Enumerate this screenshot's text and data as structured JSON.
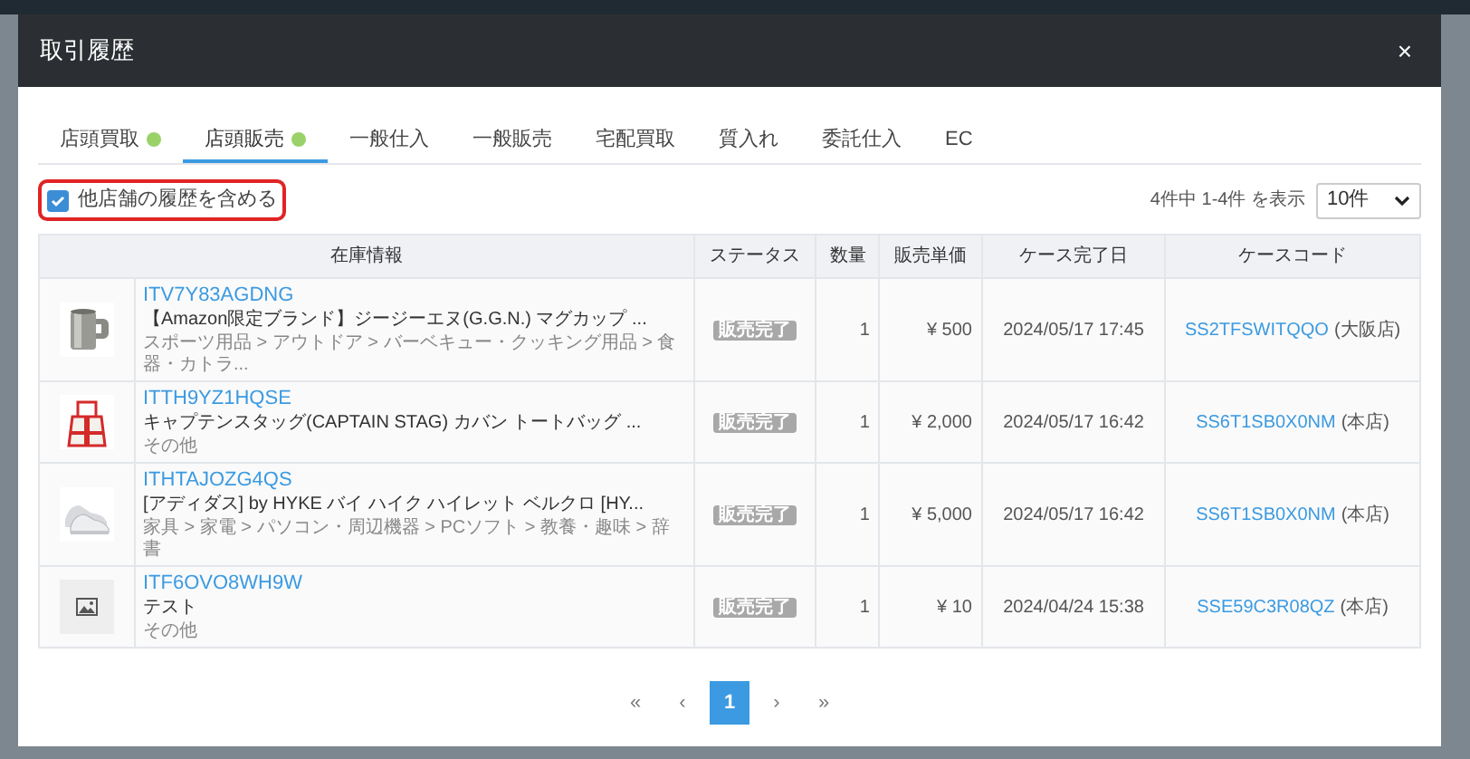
{
  "modal": {
    "title": "取引履歴",
    "close": "×"
  },
  "tabs": [
    {
      "label": "店頭買取",
      "selected": false,
      "dot": true
    },
    {
      "label": "店頭販売",
      "selected": true,
      "dot": true
    },
    {
      "label": "一般仕入",
      "selected": false,
      "dot": false
    },
    {
      "label": "一般販売",
      "selected": false,
      "dot": false
    },
    {
      "label": "宅配買取",
      "selected": false,
      "dot": false
    },
    {
      "label": "質入れ",
      "selected": false,
      "dot": false
    },
    {
      "label": "委託仕入",
      "selected": false,
      "dot": false
    },
    {
      "label": "EC",
      "selected": false,
      "dot": false
    }
  ],
  "filter": {
    "label": "他店舗の履歴を含める",
    "checked": true
  },
  "summary": "4件中 1-4件 を表示",
  "page_size": "10件",
  "table": {
    "columns": [
      "在庫情報",
      "ステータス",
      "数量",
      "販売単価",
      "ケース完了日",
      "ケースコード"
    ],
    "rows": [
      {
        "kind": "picture",
        "code": "ITV7Y83AGDNG",
        "name": "【Amazon限定ブランド】ジージーエヌ(G.G.N.) マグカップ ...",
        "category": "スポーツ用品 > アウトドア > バーベキュー・クッキング用品 > 食器・カトラ...",
        "status": "販売完了",
        "qty": "1",
        "price": "¥ 500",
        "date": "2024/05/17 17:45",
        "case_code": "SS2TFSWITQQO",
        "store": "(大阪店)"
      },
      {
        "kind": "picture",
        "code": "ITTH9YZ1HQSE",
        "name": "キャプテンスタッグ(CAPTAIN STAG) カバン トートバッグ ...",
        "category": "その他",
        "status": "販売完了",
        "qty": "1",
        "price": "¥ 2,000",
        "date": "2024/05/17 16:42",
        "case_code": "SS6T1SB0X0NM",
        "store": "(本店)"
      },
      {
        "kind": "picture",
        "code": "ITHTAJOZG4QS",
        "name": "[アディダス] by HYKE バイ ハイク ハイレット ベルクロ [HY...",
        "category": "家具 > 家電 > パソコン・周辺機器 > PCソフト > 教養・趣味 > 辞書",
        "status": "販売完了",
        "qty": "1",
        "price": "¥ 5,000",
        "date": "2024/05/17 16:42",
        "case_code": "SS6T1SB0X0NM",
        "store": "(本店)"
      },
      {
        "kind": "placeholder",
        "code": "ITF6OVO8WH9W",
        "name": "テスト",
        "category": "その他",
        "status": "販売完了",
        "qty": "1",
        "price": "¥ 10",
        "date": "2024/04/24 15:38",
        "case_code": "SSE59C3R08QZ",
        "store": "(本店)"
      }
    ]
  },
  "pagination": [
    {
      "label": "«",
      "selected": false
    },
    {
      "label": "‹",
      "selected": false
    },
    {
      "label": "1",
      "selected": true
    },
    {
      "label": "›",
      "selected": false
    },
    {
      "label": "»",
      "selected": false
    }
  ]
}
